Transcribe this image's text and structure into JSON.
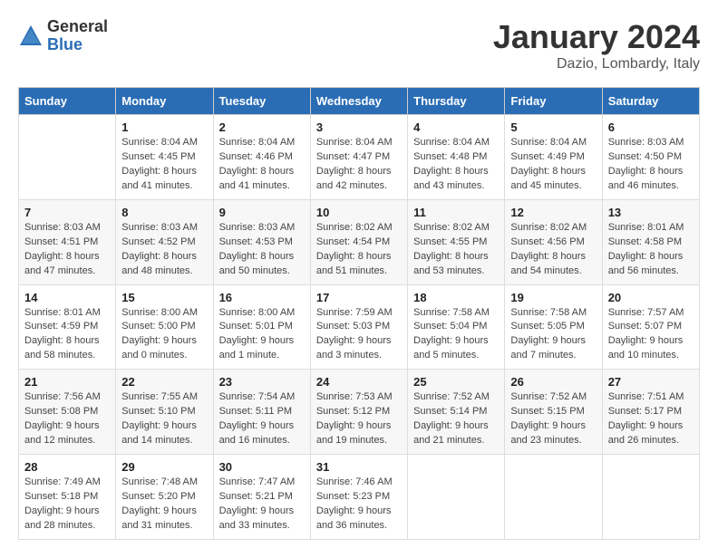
{
  "logo": {
    "general": "General",
    "blue": "Blue"
  },
  "title": "January 2024",
  "location": "Dazio, Lombardy, Italy",
  "days_of_week": [
    "Sunday",
    "Monday",
    "Tuesday",
    "Wednesday",
    "Thursday",
    "Friday",
    "Saturday"
  ],
  "weeks": [
    [
      {
        "num": "",
        "detail": ""
      },
      {
        "num": "1",
        "detail": "Sunrise: 8:04 AM\nSunset: 4:45 PM\nDaylight: 8 hours\nand 41 minutes."
      },
      {
        "num": "2",
        "detail": "Sunrise: 8:04 AM\nSunset: 4:46 PM\nDaylight: 8 hours\nand 41 minutes."
      },
      {
        "num": "3",
        "detail": "Sunrise: 8:04 AM\nSunset: 4:47 PM\nDaylight: 8 hours\nand 42 minutes."
      },
      {
        "num": "4",
        "detail": "Sunrise: 8:04 AM\nSunset: 4:48 PM\nDaylight: 8 hours\nand 43 minutes."
      },
      {
        "num": "5",
        "detail": "Sunrise: 8:04 AM\nSunset: 4:49 PM\nDaylight: 8 hours\nand 45 minutes."
      },
      {
        "num": "6",
        "detail": "Sunrise: 8:03 AM\nSunset: 4:50 PM\nDaylight: 8 hours\nand 46 minutes."
      }
    ],
    [
      {
        "num": "7",
        "detail": "Sunrise: 8:03 AM\nSunset: 4:51 PM\nDaylight: 8 hours\nand 47 minutes."
      },
      {
        "num": "8",
        "detail": "Sunrise: 8:03 AM\nSunset: 4:52 PM\nDaylight: 8 hours\nand 48 minutes."
      },
      {
        "num": "9",
        "detail": "Sunrise: 8:03 AM\nSunset: 4:53 PM\nDaylight: 8 hours\nand 50 minutes."
      },
      {
        "num": "10",
        "detail": "Sunrise: 8:02 AM\nSunset: 4:54 PM\nDaylight: 8 hours\nand 51 minutes."
      },
      {
        "num": "11",
        "detail": "Sunrise: 8:02 AM\nSunset: 4:55 PM\nDaylight: 8 hours\nand 53 minutes."
      },
      {
        "num": "12",
        "detail": "Sunrise: 8:02 AM\nSunset: 4:56 PM\nDaylight: 8 hours\nand 54 minutes."
      },
      {
        "num": "13",
        "detail": "Sunrise: 8:01 AM\nSunset: 4:58 PM\nDaylight: 8 hours\nand 56 minutes."
      }
    ],
    [
      {
        "num": "14",
        "detail": "Sunrise: 8:01 AM\nSunset: 4:59 PM\nDaylight: 8 hours\nand 58 minutes."
      },
      {
        "num": "15",
        "detail": "Sunrise: 8:00 AM\nSunset: 5:00 PM\nDaylight: 9 hours\nand 0 minutes."
      },
      {
        "num": "16",
        "detail": "Sunrise: 8:00 AM\nSunset: 5:01 PM\nDaylight: 9 hours\nand 1 minute."
      },
      {
        "num": "17",
        "detail": "Sunrise: 7:59 AM\nSunset: 5:03 PM\nDaylight: 9 hours\nand 3 minutes."
      },
      {
        "num": "18",
        "detail": "Sunrise: 7:58 AM\nSunset: 5:04 PM\nDaylight: 9 hours\nand 5 minutes."
      },
      {
        "num": "19",
        "detail": "Sunrise: 7:58 AM\nSunset: 5:05 PM\nDaylight: 9 hours\nand 7 minutes."
      },
      {
        "num": "20",
        "detail": "Sunrise: 7:57 AM\nSunset: 5:07 PM\nDaylight: 9 hours\nand 10 minutes."
      }
    ],
    [
      {
        "num": "21",
        "detail": "Sunrise: 7:56 AM\nSunset: 5:08 PM\nDaylight: 9 hours\nand 12 minutes."
      },
      {
        "num": "22",
        "detail": "Sunrise: 7:55 AM\nSunset: 5:10 PM\nDaylight: 9 hours\nand 14 minutes."
      },
      {
        "num": "23",
        "detail": "Sunrise: 7:54 AM\nSunset: 5:11 PM\nDaylight: 9 hours\nand 16 minutes."
      },
      {
        "num": "24",
        "detail": "Sunrise: 7:53 AM\nSunset: 5:12 PM\nDaylight: 9 hours\nand 19 minutes."
      },
      {
        "num": "25",
        "detail": "Sunrise: 7:52 AM\nSunset: 5:14 PM\nDaylight: 9 hours\nand 21 minutes."
      },
      {
        "num": "26",
        "detail": "Sunrise: 7:52 AM\nSunset: 5:15 PM\nDaylight: 9 hours\nand 23 minutes."
      },
      {
        "num": "27",
        "detail": "Sunrise: 7:51 AM\nSunset: 5:17 PM\nDaylight: 9 hours\nand 26 minutes."
      }
    ],
    [
      {
        "num": "28",
        "detail": "Sunrise: 7:49 AM\nSunset: 5:18 PM\nDaylight: 9 hours\nand 28 minutes."
      },
      {
        "num": "29",
        "detail": "Sunrise: 7:48 AM\nSunset: 5:20 PM\nDaylight: 9 hours\nand 31 minutes."
      },
      {
        "num": "30",
        "detail": "Sunrise: 7:47 AM\nSunset: 5:21 PM\nDaylight: 9 hours\nand 33 minutes."
      },
      {
        "num": "31",
        "detail": "Sunrise: 7:46 AM\nSunset: 5:23 PM\nDaylight: 9 hours\nand 36 minutes."
      },
      {
        "num": "",
        "detail": ""
      },
      {
        "num": "",
        "detail": ""
      },
      {
        "num": "",
        "detail": ""
      }
    ]
  ]
}
